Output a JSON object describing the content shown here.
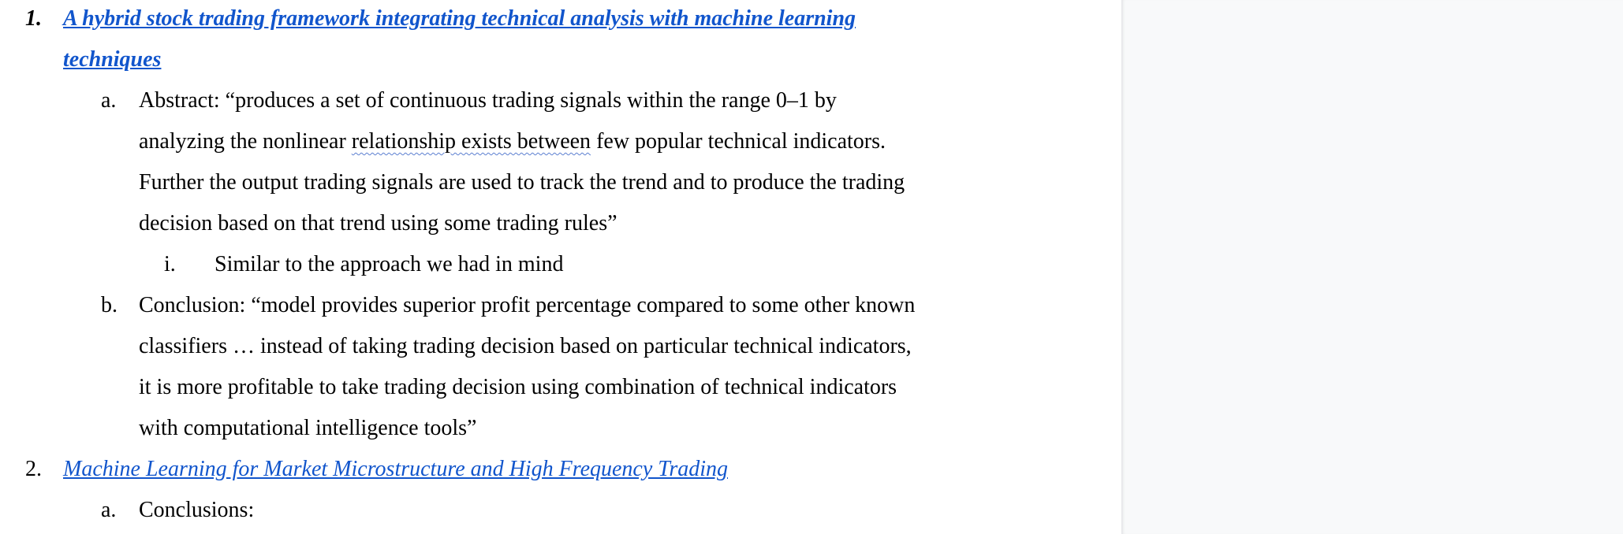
{
  "document": {
    "item1": {
      "number": "1.",
      "link_line1": "A hybrid stock trading framework integrating technical analysis with machine learning",
      "link_line2": "techniques",
      "sub_a": {
        "marker": "a.",
        "line1": "Abstract: “produces a set of continuous trading signals within the range 0–1 by",
        "line2_pre": "analyzing the nonlinear ",
        "line2_flagged": "relationship exists between",
        "line2_post": " few popular technical indicators.",
        "line3": "Further the output trading signals are used to track the trend and to produce the trading",
        "line4": "decision based on that trend using some trading rules”",
        "sub_i": {
          "marker": "i.",
          "text": "Similar to the approach we had in mind"
        }
      },
      "sub_b": {
        "marker": "b.",
        "line1": "Conclusion: “model provides superior profit percentage compared to some other known",
        "line2": "classifiers … instead of taking trading decision based on particular technical indicators,",
        "line3": "it is more profitable to take trading decision using combination of technical indicators",
        "line4": "with computational intelligence tools”"
      }
    },
    "item2": {
      "number": "2.",
      "link": "Machine Learning for Market Microstructure and High Frequency Trading",
      "sub_a": {
        "marker": "a.",
        "text": "Conclusions:"
      }
    }
  },
  "colors": {
    "link": "#1155cc",
    "text": "#000000",
    "gutter": "#f8f9fa"
  }
}
